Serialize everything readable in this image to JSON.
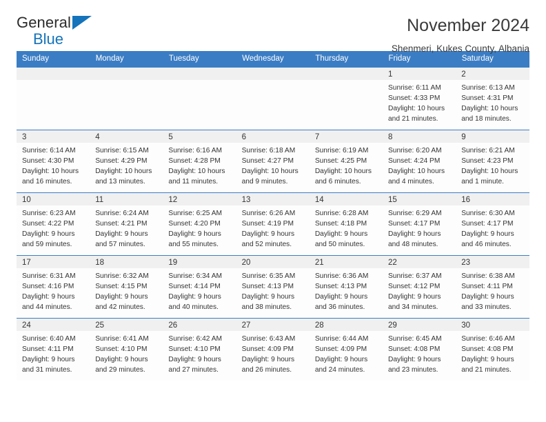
{
  "brand": {
    "name_top": "General",
    "name_bottom": "Blue",
    "accent_color": "#1473bb"
  },
  "header": {
    "title": "November 2024",
    "subtitle": "Shenmeri, Kukes County, Albania"
  },
  "theme": {
    "header_bg": "#3b7dc4",
    "daynum_bg": "#f0f0f0",
    "text": "#333333"
  },
  "weekdays": [
    "Sunday",
    "Monday",
    "Tuesday",
    "Wednesday",
    "Thursday",
    "Friday",
    "Saturday"
  ],
  "labels": {
    "sunrise_prefix": "Sunrise:",
    "sunset_prefix": "Sunset:",
    "daylight_prefix": "Daylight:"
  },
  "weeks": [
    [
      {
        "day": "",
        "empty": true
      },
      {
        "day": "",
        "empty": true
      },
      {
        "day": "",
        "empty": true
      },
      {
        "day": "",
        "empty": true
      },
      {
        "day": "",
        "empty": true
      },
      {
        "day": "1",
        "sunrise": "Sunrise: 6:11 AM",
        "sunset": "Sunset: 4:33 PM",
        "daylight": "Daylight: 10 hours and 21 minutes."
      },
      {
        "day": "2",
        "sunrise": "Sunrise: 6:13 AM",
        "sunset": "Sunset: 4:31 PM",
        "daylight": "Daylight: 10 hours and 18 minutes."
      }
    ],
    [
      {
        "day": "3",
        "sunrise": "Sunrise: 6:14 AM",
        "sunset": "Sunset: 4:30 PM",
        "daylight": "Daylight: 10 hours and 16 minutes."
      },
      {
        "day": "4",
        "sunrise": "Sunrise: 6:15 AM",
        "sunset": "Sunset: 4:29 PM",
        "daylight": "Daylight: 10 hours and 13 minutes."
      },
      {
        "day": "5",
        "sunrise": "Sunrise: 6:16 AM",
        "sunset": "Sunset: 4:28 PM",
        "daylight": "Daylight: 10 hours and 11 minutes."
      },
      {
        "day": "6",
        "sunrise": "Sunrise: 6:18 AM",
        "sunset": "Sunset: 4:27 PM",
        "daylight": "Daylight: 10 hours and 9 minutes."
      },
      {
        "day": "7",
        "sunrise": "Sunrise: 6:19 AM",
        "sunset": "Sunset: 4:25 PM",
        "daylight": "Daylight: 10 hours and 6 minutes."
      },
      {
        "day": "8",
        "sunrise": "Sunrise: 6:20 AM",
        "sunset": "Sunset: 4:24 PM",
        "daylight": "Daylight: 10 hours and 4 minutes."
      },
      {
        "day": "9",
        "sunrise": "Sunrise: 6:21 AM",
        "sunset": "Sunset: 4:23 PM",
        "daylight": "Daylight: 10 hours and 1 minute."
      }
    ],
    [
      {
        "day": "10",
        "sunrise": "Sunrise: 6:23 AM",
        "sunset": "Sunset: 4:22 PM",
        "daylight": "Daylight: 9 hours and 59 minutes."
      },
      {
        "day": "11",
        "sunrise": "Sunrise: 6:24 AM",
        "sunset": "Sunset: 4:21 PM",
        "daylight": "Daylight: 9 hours and 57 minutes."
      },
      {
        "day": "12",
        "sunrise": "Sunrise: 6:25 AM",
        "sunset": "Sunset: 4:20 PM",
        "daylight": "Daylight: 9 hours and 55 minutes."
      },
      {
        "day": "13",
        "sunrise": "Sunrise: 6:26 AM",
        "sunset": "Sunset: 4:19 PM",
        "daylight": "Daylight: 9 hours and 52 minutes."
      },
      {
        "day": "14",
        "sunrise": "Sunrise: 6:28 AM",
        "sunset": "Sunset: 4:18 PM",
        "daylight": "Daylight: 9 hours and 50 minutes."
      },
      {
        "day": "15",
        "sunrise": "Sunrise: 6:29 AM",
        "sunset": "Sunset: 4:17 PM",
        "daylight": "Daylight: 9 hours and 48 minutes."
      },
      {
        "day": "16",
        "sunrise": "Sunrise: 6:30 AM",
        "sunset": "Sunset: 4:17 PM",
        "daylight": "Daylight: 9 hours and 46 minutes."
      }
    ],
    [
      {
        "day": "17",
        "sunrise": "Sunrise: 6:31 AM",
        "sunset": "Sunset: 4:16 PM",
        "daylight": "Daylight: 9 hours and 44 minutes."
      },
      {
        "day": "18",
        "sunrise": "Sunrise: 6:32 AM",
        "sunset": "Sunset: 4:15 PM",
        "daylight": "Daylight: 9 hours and 42 minutes."
      },
      {
        "day": "19",
        "sunrise": "Sunrise: 6:34 AM",
        "sunset": "Sunset: 4:14 PM",
        "daylight": "Daylight: 9 hours and 40 minutes."
      },
      {
        "day": "20",
        "sunrise": "Sunrise: 6:35 AM",
        "sunset": "Sunset: 4:13 PM",
        "daylight": "Daylight: 9 hours and 38 minutes."
      },
      {
        "day": "21",
        "sunrise": "Sunrise: 6:36 AM",
        "sunset": "Sunset: 4:13 PM",
        "daylight": "Daylight: 9 hours and 36 minutes."
      },
      {
        "day": "22",
        "sunrise": "Sunrise: 6:37 AM",
        "sunset": "Sunset: 4:12 PM",
        "daylight": "Daylight: 9 hours and 34 minutes."
      },
      {
        "day": "23",
        "sunrise": "Sunrise: 6:38 AM",
        "sunset": "Sunset: 4:11 PM",
        "daylight": "Daylight: 9 hours and 33 minutes."
      }
    ],
    [
      {
        "day": "24",
        "sunrise": "Sunrise: 6:40 AM",
        "sunset": "Sunset: 4:11 PM",
        "daylight": "Daylight: 9 hours and 31 minutes."
      },
      {
        "day": "25",
        "sunrise": "Sunrise: 6:41 AM",
        "sunset": "Sunset: 4:10 PM",
        "daylight": "Daylight: 9 hours and 29 minutes."
      },
      {
        "day": "26",
        "sunrise": "Sunrise: 6:42 AM",
        "sunset": "Sunset: 4:10 PM",
        "daylight": "Daylight: 9 hours and 27 minutes."
      },
      {
        "day": "27",
        "sunrise": "Sunrise: 6:43 AM",
        "sunset": "Sunset: 4:09 PM",
        "daylight": "Daylight: 9 hours and 26 minutes."
      },
      {
        "day": "28",
        "sunrise": "Sunrise: 6:44 AM",
        "sunset": "Sunset: 4:09 PM",
        "daylight": "Daylight: 9 hours and 24 minutes."
      },
      {
        "day": "29",
        "sunrise": "Sunrise: 6:45 AM",
        "sunset": "Sunset: 4:08 PM",
        "daylight": "Daylight: 9 hours and 23 minutes."
      },
      {
        "day": "30",
        "sunrise": "Sunrise: 6:46 AM",
        "sunset": "Sunset: 4:08 PM",
        "daylight": "Daylight: 9 hours and 21 minutes."
      }
    ]
  ]
}
